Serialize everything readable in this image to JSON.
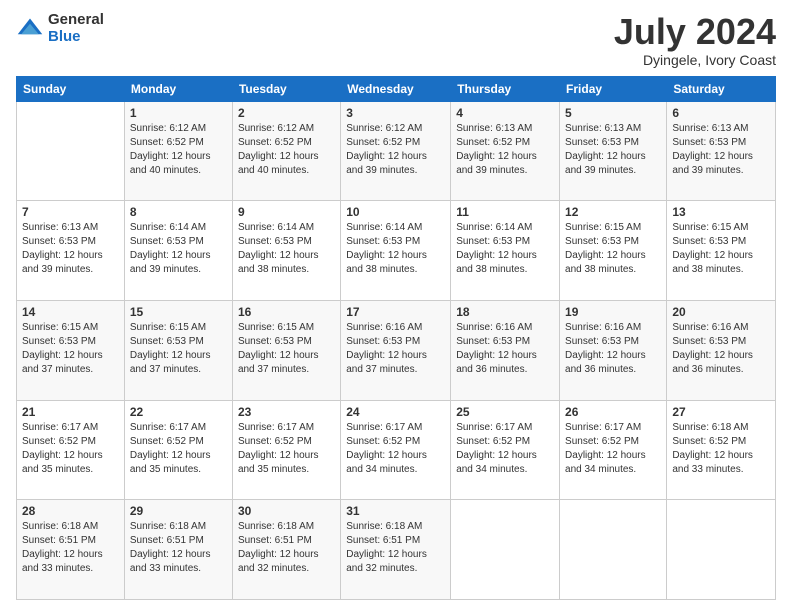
{
  "logo": {
    "general": "General",
    "blue": "Blue"
  },
  "title": "July 2024",
  "location": "Dyingele, Ivory Coast",
  "days_of_week": [
    "Sunday",
    "Monday",
    "Tuesday",
    "Wednesday",
    "Thursday",
    "Friday",
    "Saturday"
  ],
  "weeks": [
    [
      {
        "day": "",
        "sunrise": "",
        "sunset": "",
        "daylight": ""
      },
      {
        "day": "1",
        "sunrise": "Sunrise: 6:12 AM",
        "sunset": "Sunset: 6:52 PM",
        "daylight": "Daylight: 12 hours and 40 minutes."
      },
      {
        "day": "2",
        "sunrise": "Sunrise: 6:12 AM",
        "sunset": "Sunset: 6:52 PM",
        "daylight": "Daylight: 12 hours and 40 minutes."
      },
      {
        "day": "3",
        "sunrise": "Sunrise: 6:12 AM",
        "sunset": "Sunset: 6:52 PM",
        "daylight": "Daylight: 12 hours and 39 minutes."
      },
      {
        "day": "4",
        "sunrise": "Sunrise: 6:13 AM",
        "sunset": "Sunset: 6:52 PM",
        "daylight": "Daylight: 12 hours and 39 minutes."
      },
      {
        "day": "5",
        "sunrise": "Sunrise: 6:13 AM",
        "sunset": "Sunset: 6:53 PM",
        "daylight": "Daylight: 12 hours and 39 minutes."
      },
      {
        "day": "6",
        "sunrise": "Sunrise: 6:13 AM",
        "sunset": "Sunset: 6:53 PM",
        "daylight": "Daylight: 12 hours and 39 minutes."
      }
    ],
    [
      {
        "day": "7",
        "sunrise": "Sunrise: 6:13 AM",
        "sunset": "Sunset: 6:53 PM",
        "daylight": "Daylight: 12 hours and 39 minutes."
      },
      {
        "day": "8",
        "sunrise": "Sunrise: 6:14 AM",
        "sunset": "Sunset: 6:53 PM",
        "daylight": "Daylight: 12 hours and 39 minutes."
      },
      {
        "day": "9",
        "sunrise": "Sunrise: 6:14 AM",
        "sunset": "Sunset: 6:53 PM",
        "daylight": "Daylight: 12 hours and 38 minutes."
      },
      {
        "day": "10",
        "sunrise": "Sunrise: 6:14 AM",
        "sunset": "Sunset: 6:53 PM",
        "daylight": "Daylight: 12 hours and 38 minutes."
      },
      {
        "day": "11",
        "sunrise": "Sunrise: 6:14 AM",
        "sunset": "Sunset: 6:53 PM",
        "daylight": "Daylight: 12 hours and 38 minutes."
      },
      {
        "day": "12",
        "sunrise": "Sunrise: 6:15 AM",
        "sunset": "Sunset: 6:53 PM",
        "daylight": "Daylight: 12 hours and 38 minutes."
      },
      {
        "day": "13",
        "sunrise": "Sunrise: 6:15 AM",
        "sunset": "Sunset: 6:53 PM",
        "daylight": "Daylight: 12 hours and 38 minutes."
      }
    ],
    [
      {
        "day": "14",
        "sunrise": "Sunrise: 6:15 AM",
        "sunset": "Sunset: 6:53 PM",
        "daylight": "Daylight: 12 hours and 37 minutes."
      },
      {
        "day": "15",
        "sunrise": "Sunrise: 6:15 AM",
        "sunset": "Sunset: 6:53 PM",
        "daylight": "Daylight: 12 hours and 37 minutes."
      },
      {
        "day": "16",
        "sunrise": "Sunrise: 6:15 AM",
        "sunset": "Sunset: 6:53 PM",
        "daylight": "Daylight: 12 hours and 37 minutes."
      },
      {
        "day": "17",
        "sunrise": "Sunrise: 6:16 AM",
        "sunset": "Sunset: 6:53 PM",
        "daylight": "Daylight: 12 hours and 37 minutes."
      },
      {
        "day": "18",
        "sunrise": "Sunrise: 6:16 AM",
        "sunset": "Sunset: 6:53 PM",
        "daylight": "Daylight: 12 hours and 36 minutes."
      },
      {
        "day": "19",
        "sunrise": "Sunrise: 6:16 AM",
        "sunset": "Sunset: 6:53 PM",
        "daylight": "Daylight: 12 hours and 36 minutes."
      },
      {
        "day": "20",
        "sunrise": "Sunrise: 6:16 AM",
        "sunset": "Sunset: 6:53 PM",
        "daylight": "Daylight: 12 hours and 36 minutes."
      }
    ],
    [
      {
        "day": "21",
        "sunrise": "Sunrise: 6:17 AM",
        "sunset": "Sunset: 6:52 PM",
        "daylight": "Daylight: 12 hours and 35 minutes."
      },
      {
        "day": "22",
        "sunrise": "Sunrise: 6:17 AM",
        "sunset": "Sunset: 6:52 PM",
        "daylight": "Daylight: 12 hours and 35 minutes."
      },
      {
        "day": "23",
        "sunrise": "Sunrise: 6:17 AM",
        "sunset": "Sunset: 6:52 PM",
        "daylight": "Daylight: 12 hours and 35 minutes."
      },
      {
        "day": "24",
        "sunrise": "Sunrise: 6:17 AM",
        "sunset": "Sunset: 6:52 PM",
        "daylight": "Daylight: 12 hours and 34 minutes."
      },
      {
        "day": "25",
        "sunrise": "Sunrise: 6:17 AM",
        "sunset": "Sunset: 6:52 PM",
        "daylight": "Daylight: 12 hours and 34 minutes."
      },
      {
        "day": "26",
        "sunrise": "Sunrise: 6:17 AM",
        "sunset": "Sunset: 6:52 PM",
        "daylight": "Daylight: 12 hours and 34 minutes."
      },
      {
        "day": "27",
        "sunrise": "Sunrise: 6:18 AM",
        "sunset": "Sunset: 6:52 PM",
        "daylight": "Daylight: 12 hours and 33 minutes."
      }
    ],
    [
      {
        "day": "28",
        "sunrise": "Sunrise: 6:18 AM",
        "sunset": "Sunset: 6:51 PM",
        "daylight": "Daylight: 12 hours and 33 minutes."
      },
      {
        "day": "29",
        "sunrise": "Sunrise: 6:18 AM",
        "sunset": "Sunset: 6:51 PM",
        "daylight": "Daylight: 12 hours and 33 minutes."
      },
      {
        "day": "30",
        "sunrise": "Sunrise: 6:18 AM",
        "sunset": "Sunset: 6:51 PM",
        "daylight": "Daylight: 12 hours and 32 minutes."
      },
      {
        "day": "31",
        "sunrise": "Sunrise: 6:18 AM",
        "sunset": "Sunset: 6:51 PM",
        "daylight": "Daylight: 12 hours and 32 minutes."
      },
      {
        "day": "",
        "sunrise": "",
        "sunset": "",
        "daylight": ""
      },
      {
        "day": "",
        "sunrise": "",
        "sunset": "",
        "daylight": ""
      },
      {
        "day": "",
        "sunrise": "",
        "sunset": "",
        "daylight": ""
      }
    ]
  ]
}
